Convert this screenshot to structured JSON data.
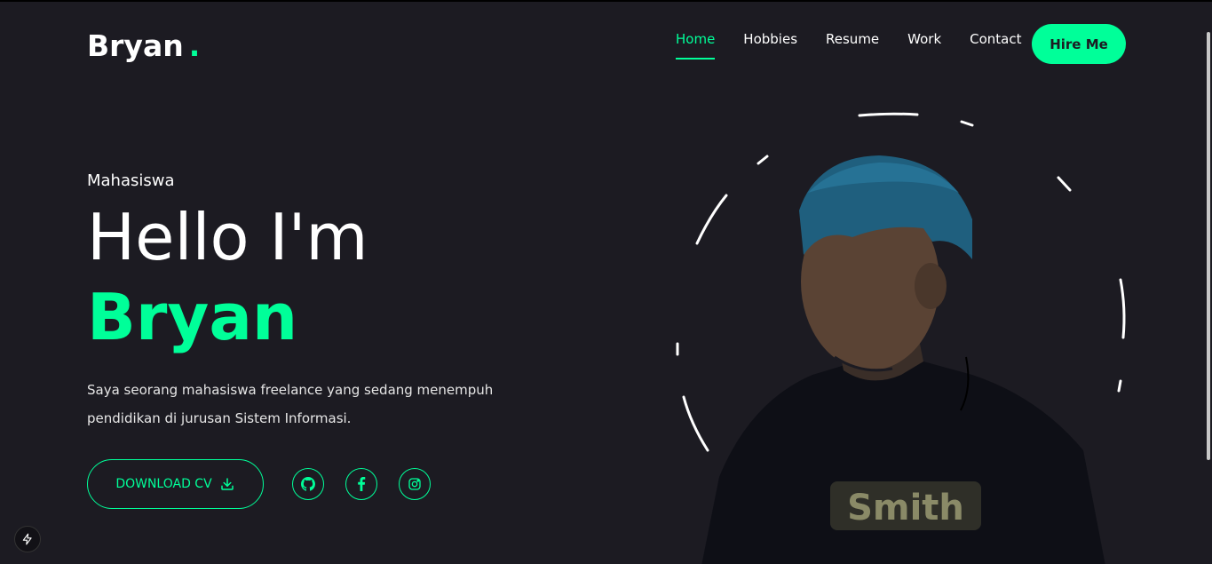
{
  "brand": {
    "name": "Bryan",
    "dot": "."
  },
  "nav": {
    "items": [
      {
        "label": "Home",
        "active": true
      },
      {
        "label": "Hobbies"
      },
      {
        "label": "Resume"
      },
      {
        "label": "Work"
      },
      {
        "label": "Contact"
      }
    ],
    "cta_label": "Hire Me"
  },
  "hero": {
    "role": "Mahasiswa",
    "greeting": "Hello I'm",
    "name": "Bryan",
    "description": "Saya seorang mahasiswa freelance yang sedang menempuh pendidikan di jurusan Sistem Informasi.",
    "download_label": "DOWNLOAD CV",
    "socials": [
      "github-icon",
      "facebook-icon",
      "instagram-icon"
    ],
    "shirt_text": "Smith"
  },
  "colors": {
    "accent": "#00ff99",
    "background": "#1c1b22",
    "text": "#ffffff"
  }
}
